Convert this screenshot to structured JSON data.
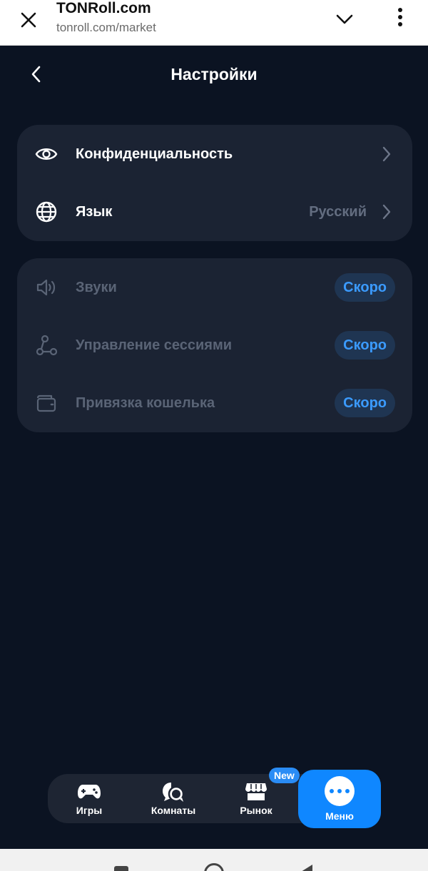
{
  "browser": {
    "title": "TONRoll.com",
    "url": "tonroll.com/market"
  },
  "header": {
    "title": "Настройки"
  },
  "settings_main": [
    {
      "label": "Конфиденциальность",
      "icon": "eye-icon",
      "value": ""
    },
    {
      "label": "Язык",
      "icon": "globe-icon",
      "value": "Русский"
    }
  ],
  "settings_soon": [
    {
      "label": "Звуки",
      "icon": "speaker-icon",
      "badge": "Скоро"
    },
    {
      "label": "Управление сессиями",
      "icon": "share-nodes-icon",
      "badge": "Скоро"
    },
    {
      "label": "Привязка кошелька",
      "icon": "wallet-icon",
      "badge": "Скоро"
    }
  ],
  "bottom_nav": {
    "games": "Игры",
    "rooms": "Комнаты",
    "market": "Рынок",
    "market_badge": "New",
    "menu": "Меню"
  },
  "colors": {
    "background": "#0b1322",
    "card": "#1b2333",
    "accent": "#0f87ff",
    "soon_text": "#3b9bff"
  }
}
